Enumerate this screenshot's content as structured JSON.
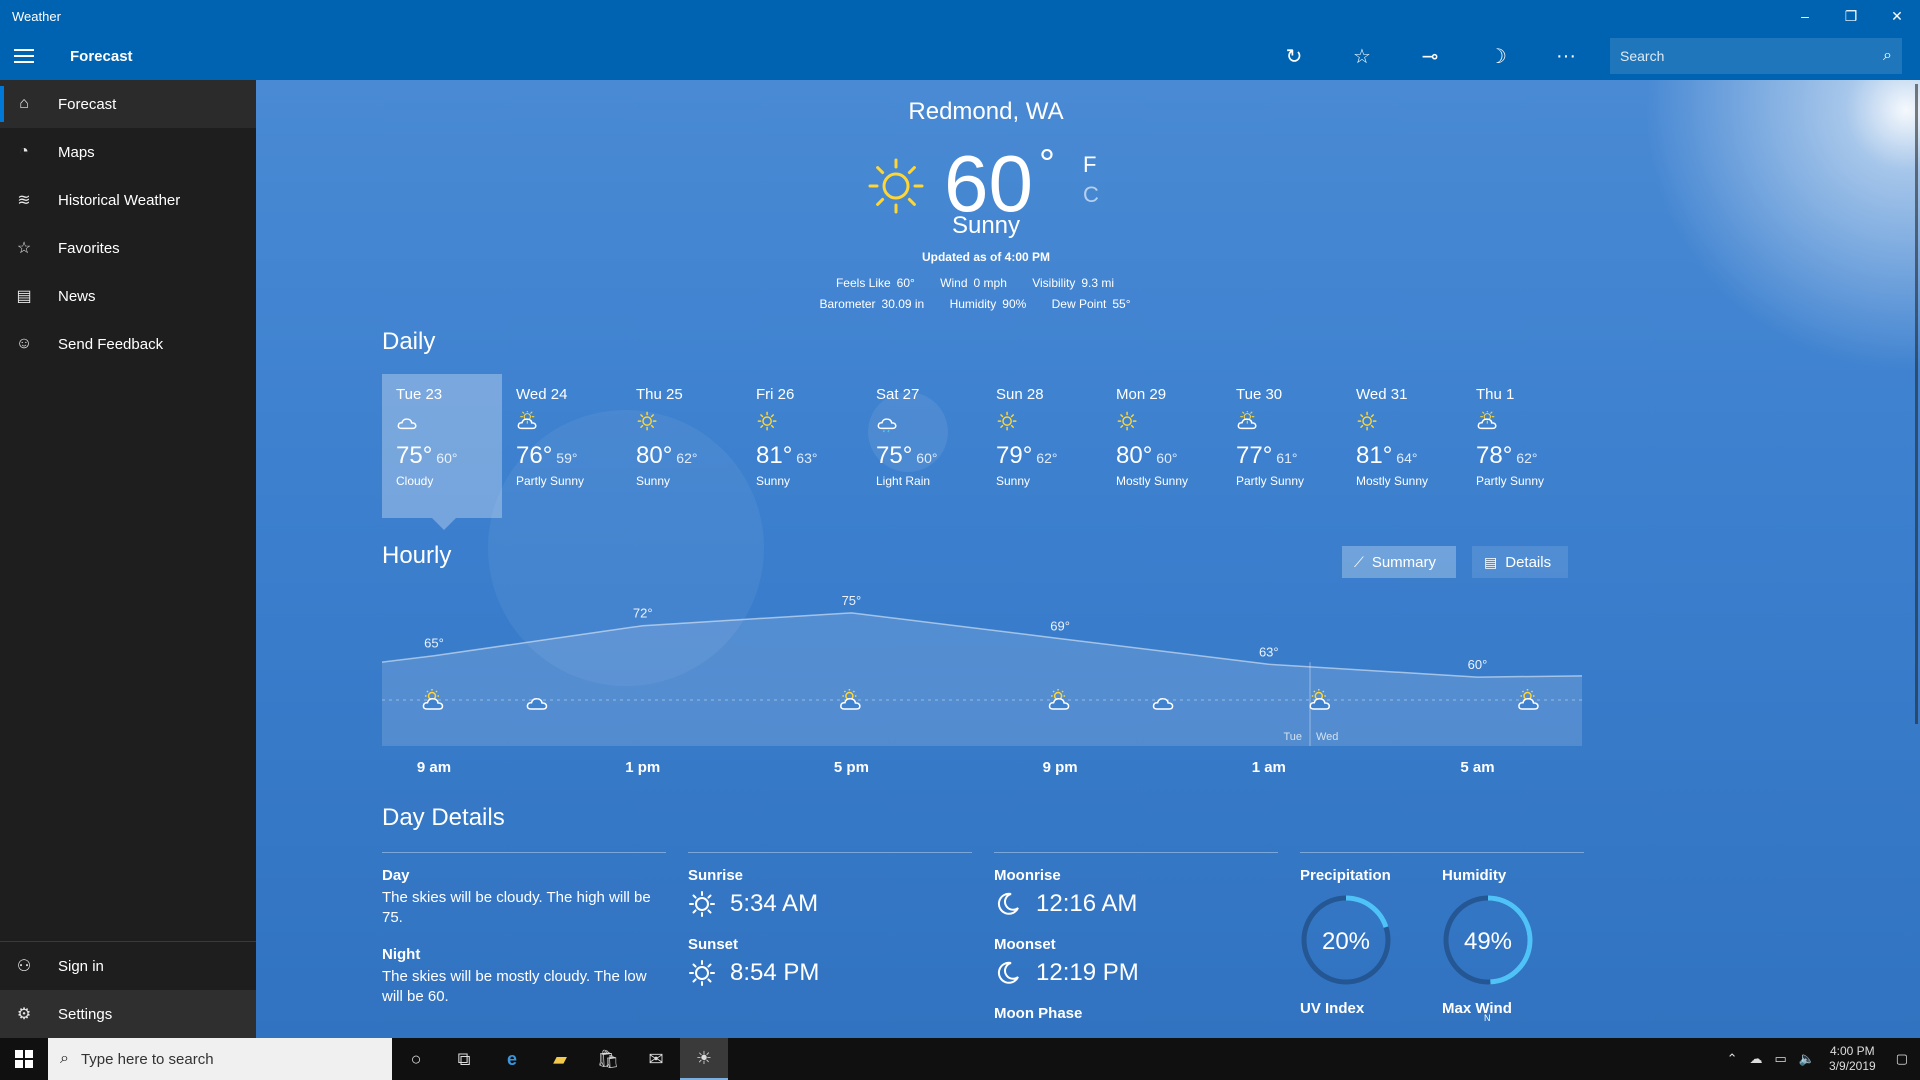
{
  "window": {
    "title": "Weather",
    "minimize_icon": "minimize-icon",
    "maximize_icon": "restore-icon",
    "close_icon": "close-icon"
  },
  "header": {
    "title": "Forecast",
    "search_placeholder": "Search"
  },
  "sidebar": {
    "items": [
      {
        "label": "Forecast",
        "icon": "home-icon",
        "active": true
      },
      {
        "label": "Maps",
        "icon": "radar-icon"
      },
      {
        "label": "Historical Weather",
        "icon": "chart-icon"
      },
      {
        "label": "Favorites",
        "icon": "favorites-icon"
      },
      {
        "label": "News",
        "icon": "news-icon"
      },
      {
        "label": "Send Feedback",
        "icon": "feedback-icon"
      }
    ],
    "bottom": [
      {
        "label": "Sign in",
        "icon": "person-icon"
      },
      {
        "label": "Settings",
        "icon": "gear-icon"
      }
    ]
  },
  "current": {
    "location": "Redmond, WA",
    "temperature": "60",
    "degree": "°",
    "unit_f": "F",
    "unit_c": "C",
    "condition": "Sunny",
    "updated": "Updated as of 4:00 PM",
    "feels_like_label": "Feels Like",
    "feels_like": "60°",
    "wind_label": "Wind",
    "wind": "0 mph",
    "visibility_label": "Visibility",
    "visibility": "9.3 mi",
    "barometer_label": "Barometer",
    "barometer": "30.09 in",
    "humidity_label": "Humidity",
    "humidity": "90%",
    "dew_point_label": "Dew Point",
    "dew_point": "55°"
  },
  "daily": {
    "title": "Daily",
    "days": [
      {
        "day": "Tue 23",
        "hi": "75°",
        "lo": "60°",
        "cond": "Cloudy",
        "icon": "cloudy"
      },
      {
        "day": "Wed 24",
        "hi": "76°",
        "lo": "59°",
        "cond": "Partly Sunny",
        "icon": "partly"
      },
      {
        "day": "Thu 25",
        "hi": "80°",
        "lo": "62°",
        "cond": "Sunny",
        "icon": "sunny"
      },
      {
        "day": "Fri 26",
        "hi": "81°",
        "lo": "63°",
        "cond": "Sunny",
        "icon": "sunny"
      },
      {
        "day": "Sat 27",
        "hi": "75°",
        "lo": "60°",
        "cond": "Light Rain",
        "icon": "rain"
      },
      {
        "day": "Sun 28",
        "hi": "79°",
        "lo": "62°",
        "cond": "Sunny",
        "icon": "sunny"
      },
      {
        "day": "Mon 29",
        "hi": "80°",
        "lo": "60°",
        "cond": "Mostly Sunny",
        "icon": "sunny"
      },
      {
        "day": "Tue 30",
        "hi": "77°",
        "lo": "61°",
        "cond": "Partly Sunny",
        "icon": "partly"
      },
      {
        "day": "Wed 31",
        "hi": "81°",
        "lo": "64°",
        "cond": "Mostly Sunny",
        "icon": "sunny"
      },
      {
        "day": "Thu 1",
        "hi": "78°",
        "lo": "62°",
        "cond": "Partly Sunny",
        "icon": "partly"
      }
    ]
  },
  "hourly": {
    "title": "Hourly",
    "summary_label": "Summary",
    "details_label": "Details",
    "day_divider": [
      "Tue",
      "Wed"
    ]
  },
  "chart_data": {
    "type": "area",
    "x": [
      "9 am",
      "1 pm",
      "5 pm",
      "9 pm",
      "1 am",
      "5 am"
    ],
    "values": [
      65,
      72,
      75,
      69,
      63,
      60
    ],
    "labels": [
      "65°",
      "72°",
      "75°",
      "69°",
      "63°",
      "60°"
    ],
    "icons": [
      "partly",
      "cloudy",
      "partly",
      "partly",
      "cloudy",
      "partly",
      "partly"
    ]
  },
  "day_details": {
    "title": "Day Details",
    "day_label": "Day",
    "day_text": "The skies will be cloudy. The high will be 75.",
    "night_label": "Night",
    "night_text": "The skies will be mostly cloudy. The low will be 60.",
    "sunrise_label": "Sunrise",
    "sunrise": "5:34 AM",
    "sunset_label": "Sunset",
    "sunset": "8:54 PM",
    "moonrise_label": "Moonrise",
    "moonrise": "12:16 AM",
    "moonset_label": "Moonset",
    "moonset": "12:19 PM",
    "moon_phase_label": "Moon Phase",
    "precip_label": "Precipitation",
    "precip": "20%",
    "precip_fraction": 0.2,
    "humidity_label": "Humidity",
    "humidity": "49%",
    "humidity_fraction": 0.49,
    "uv_label": "UV Index",
    "max_wind_label": "Max Wind",
    "max_wind_compass": "N"
  },
  "taskbar": {
    "search_placeholder": "Type here to search",
    "time": "4:00 PM",
    "date": "3/9/2019"
  },
  "colors": {
    "title_bar": "#0063b1",
    "sidebar": "#1e1e1e",
    "accent": "#0078d7",
    "gauge": "#4fc3f7",
    "sun": "#ffd633"
  }
}
